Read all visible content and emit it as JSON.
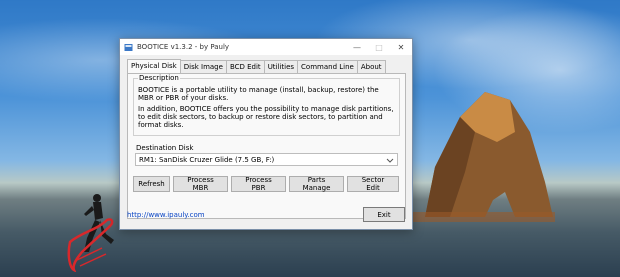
{
  "window": {
    "title": "BOOTICE v1.3.2 - by Pauly",
    "controls": {
      "minimize": "—",
      "maximize": "□",
      "close": "✕"
    }
  },
  "tabs": [
    "Physical Disk",
    "Disk Image",
    "BCD Edit",
    "Utilities",
    "Command Line",
    "About"
  ],
  "description": {
    "title": "Description",
    "paragraph1": "BOOTICE is a portable utility to manage (install, backup, restore) the MBR or PBR of your disks.",
    "paragraph2": "In addition, BOOTICE offers you the possibility to manage disk partitions, to edit disk sectors, to backup or restore disk sectors, to partition and format disks."
  },
  "destination": {
    "label": "Destination Disk",
    "selected": "RM1: SanDisk Cruzer Glide (7.5 GB, F:)"
  },
  "buttons": {
    "refresh": "Refresh",
    "process_mbr": "Process MBR",
    "process_pbr": "Process PBR",
    "parts_manage": "Parts Manage",
    "sector_edit": "Sector Edit",
    "exit": "Exit"
  },
  "footer": {
    "link": "http://www.ipauly.com"
  },
  "colors": {
    "link": "#0a45c4",
    "window_bg": "#f0f0f0"
  },
  "icons": [
    "app-icon",
    "chevron-down-icon",
    "minimize-icon",
    "maximize-icon",
    "close-icon"
  ]
}
